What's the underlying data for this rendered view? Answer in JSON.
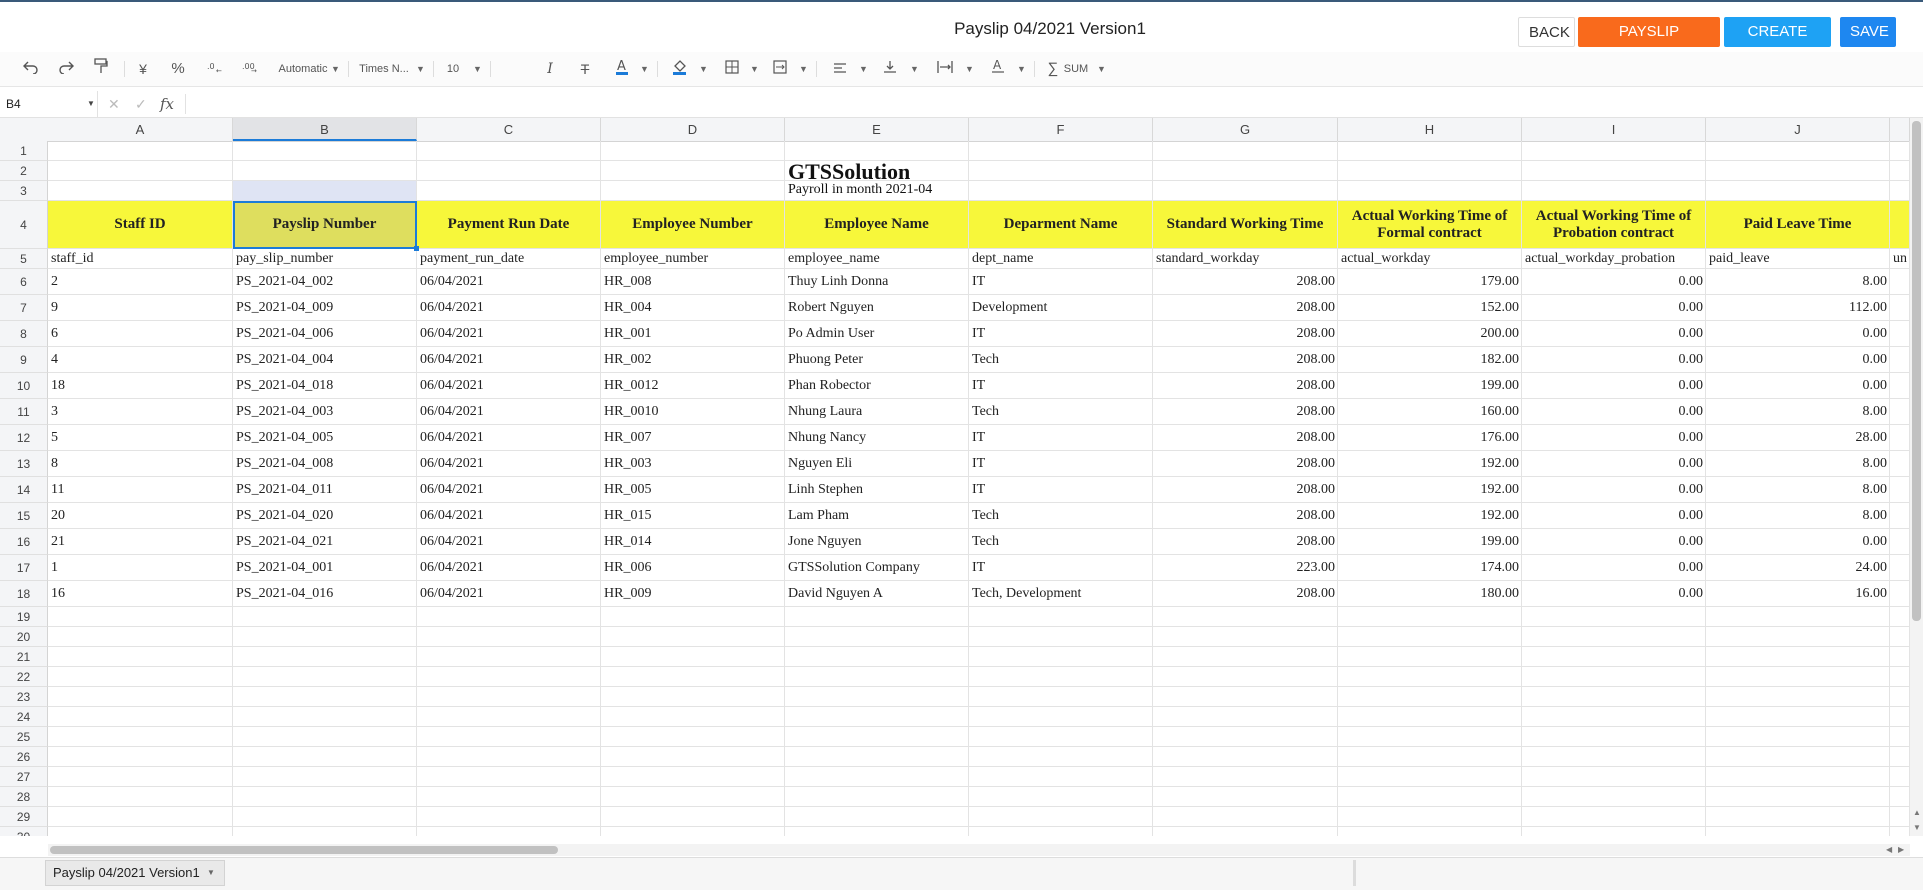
{
  "header": {
    "title": "Payslip 04/2021 Version1",
    "buttons": {
      "back": "BACK",
      "payslip_closing": "PAYSLIP CLOSING",
      "create_file": "CREATE FILE",
      "save": "SAVE"
    },
    "colors": {
      "payslip_closing": "#f96a1c",
      "create_file": "#1ea2f4",
      "save": "#1e87f0",
      "header_fill": "#f7f73a"
    }
  },
  "toolbar": {
    "currency": "¥",
    "percent": "%",
    "number_format": "Automatic",
    "font_family": "Times N...",
    "font_size": "10",
    "sum": "SUM",
    "icons": [
      "undo-icon",
      "redo-icon",
      "paint-format-icon",
      "currency-icon",
      "percent-icon",
      "decrease-decimal-icon",
      "increase-decimal-icon",
      "italic-icon",
      "strikethrough-icon",
      "text-color-icon",
      "fill-color-icon",
      "borders-icon",
      "merge-cells-icon",
      "horizontal-align-icon",
      "vertical-align-icon",
      "text-wrap-icon",
      "text-rotation-icon",
      "sum-icon"
    ]
  },
  "formula_bar": {
    "name_box": "B4",
    "fx": "fx",
    "formula": ""
  },
  "grid": {
    "columns": [
      "A",
      "B",
      "C",
      "D",
      "E",
      "F",
      "G",
      "H",
      "I",
      "J"
    ],
    "selected_column": "B",
    "row_numbers": [
      "1",
      "2",
      "3",
      "4",
      "5",
      "6",
      "7",
      "8",
      "9",
      "10",
      "11",
      "12",
      "13",
      "14",
      "15",
      "16",
      "17",
      "18",
      "19",
      "20",
      "21",
      "22",
      "23",
      "24",
      "25",
      "26",
      "27",
      "28",
      "29",
      "30"
    ],
    "company_title": "GTSSolution",
    "payroll_subtitle": "Payroll in month 2021-04",
    "headers": [
      "Staff ID",
      "Payslip Number",
      "Payment Run Date",
      "Employee Number",
      "Employee Name",
      "Deparment Name",
      "Standard Working Time",
      "Actual Working Time of Formal contract",
      "Actual Working Time of Probation contract",
      "Paid Leave Time"
    ],
    "field_keys": [
      "staff_id",
      "pay_slip_number",
      "payment_run_date",
      "employee_number",
      "employee_name",
      "dept_name",
      "standard_workday",
      "actual_workday",
      "actual_workday_probation",
      "paid_leave"
    ],
    "overflow_key": "un",
    "rows": [
      [
        "2",
        "PS_2021-04_002",
        "06/04/2021",
        "HR_008",
        "Thuy Linh  Donna",
        "IT",
        "208.00",
        "179.00",
        "0.00",
        "8.00"
      ],
      [
        "9",
        "PS_2021-04_009",
        "06/04/2021",
        "HR_004",
        "Robert Nguyen",
        "Development",
        "208.00",
        "152.00",
        "0.00",
        "112.00"
      ],
      [
        "6",
        "PS_2021-04_006",
        "06/04/2021",
        "HR_001",
        "Po Admin User",
        "IT",
        "208.00",
        "200.00",
        "0.00",
        "0.00"
      ],
      [
        "4",
        "PS_2021-04_004",
        "06/04/2021",
        "HR_002",
        "Phuong Peter",
        "Tech",
        "208.00",
        "182.00",
        "0.00",
        "0.00"
      ],
      [
        "18",
        "PS_2021-04_018",
        "06/04/2021",
        "HR_0012",
        "Phan Robector",
        "IT",
        "208.00",
        "199.00",
        "0.00",
        "0.00"
      ],
      [
        "3",
        "PS_2021-04_003",
        "06/04/2021",
        "HR_0010",
        "Nhung Laura",
        "Tech",
        "208.00",
        "160.00",
        "0.00",
        "8.00"
      ],
      [
        "5",
        "PS_2021-04_005",
        "06/04/2021",
        "HR_007",
        "Nhung Nancy",
        "IT",
        "208.00",
        "176.00",
        "0.00",
        "28.00"
      ],
      [
        "8",
        "PS_2021-04_008",
        "06/04/2021",
        "HR_003",
        "Nguyen Eli",
        "IT",
        "208.00",
        "192.00",
        "0.00",
        "8.00"
      ],
      [
        "11",
        "PS_2021-04_011",
        "06/04/2021",
        "HR_005",
        "Linh Stephen",
        "IT",
        "208.00",
        "192.00",
        "0.00",
        "8.00"
      ],
      [
        "20",
        "PS_2021-04_020",
        "06/04/2021",
        "HR_015",
        "Lam Pham",
        "Tech",
        "208.00",
        "192.00",
        "0.00",
        "8.00"
      ],
      [
        "21",
        "PS_2021-04_021",
        "06/04/2021",
        "HR_014",
        "Jone  Nguyen",
        "Tech",
        "208.00",
        "199.00",
        "0.00",
        "0.00"
      ],
      [
        "1",
        "PS_2021-04_001",
        "06/04/2021",
        "HR_006",
        "GTSSolution Company",
        "IT",
        "223.00",
        "174.00",
        "0.00",
        "24.00"
      ],
      [
        "16",
        "PS_2021-04_016",
        "06/04/2021",
        "HR_009",
        "David Nguyen A",
        "Tech, Development",
        "208.00",
        "180.00",
        "0.00",
        "16.00"
      ]
    ]
  },
  "sheet_tabs": [
    "Payslip 04/2021 Version1"
  ]
}
